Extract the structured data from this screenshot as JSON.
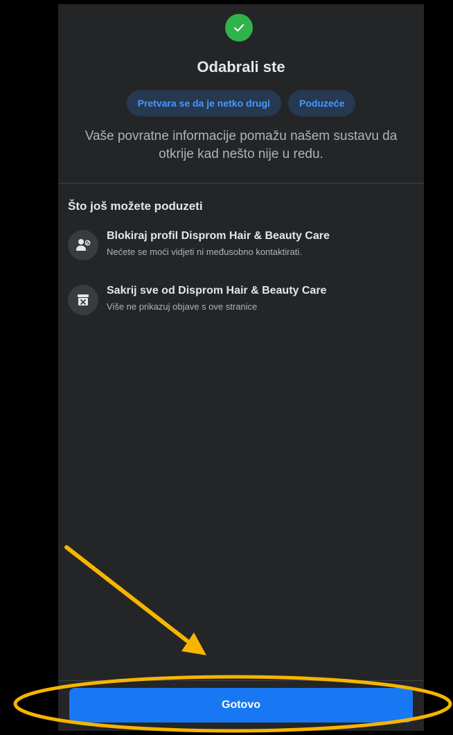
{
  "header": {
    "check_icon": "checkmark-icon",
    "title": "Odabrali ste"
  },
  "chips": [
    {
      "label": "Pretvara se da je netko drugi"
    },
    {
      "label": "Poduzeće"
    }
  ],
  "subtitle": "Vaše povratne informacije pomažu našem sustavu da otkrije kad nešto nije u redu.",
  "more_actions": {
    "title": "Što još možete poduzeti",
    "options": [
      {
        "icon": "block-profile-icon",
        "title": "Blokiraj profil Disprom Hair & Beauty Care",
        "subtitle": "Nećete se moći vidjeti ni međusobno kontaktirati."
      },
      {
        "icon": "hide-all-icon",
        "title": "Sakrij sve od Disprom Hair & Beauty Care",
        "subtitle": "Više ne prikazuj objave s ove stranice"
      }
    ]
  },
  "footer": {
    "done_label": "Gotovo"
  },
  "colors": {
    "background": "#242526",
    "accent": "#1877f2",
    "success": "#2fb34a",
    "annotation": "#f7b500"
  }
}
